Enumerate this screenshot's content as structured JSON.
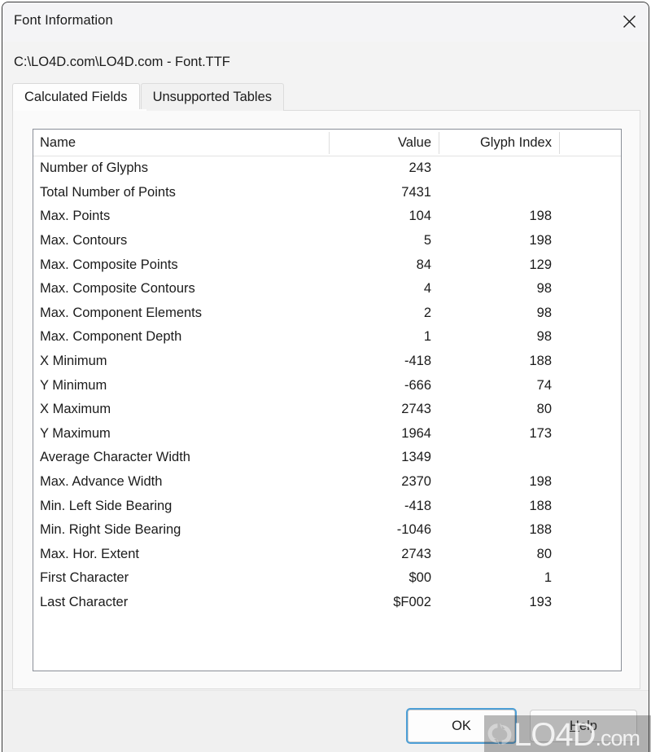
{
  "window": {
    "title": "Font Information",
    "close_icon": "close-icon"
  },
  "path": "C:\\LO4D.com\\LO4D.com - Font.TTF",
  "tabs": [
    {
      "label": "Calculated Fields",
      "active": true
    },
    {
      "label": "Unsupported Tables",
      "active": false
    }
  ],
  "table": {
    "columns": [
      "Name",
      "Value",
      "Glyph Index",
      ""
    ],
    "rows": [
      {
        "name": "Number of Glyphs",
        "value": "243",
        "glyph": ""
      },
      {
        "name": "Total Number of Points",
        "value": "7431",
        "glyph": ""
      },
      {
        "name": "Max. Points",
        "value": "104",
        "glyph": "198"
      },
      {
        "name": "Max. Contours",
        "value": "5",
        "glyph": "198"
      },
      {
        "name": "Max. Composite Points",
        "value": "84",
        "glyph": "129"
      },
      {
        "name": "Max. Composite Contours",
        "value": "4",
        "glyph": "98"
      },
      {
        "name": "Max. Component Elements",
        "value": "2",
        "glyph": "98"
      },
      {
        "name": "Max. Component Depth",
        "value": "1",
        "glyph": "98"
      },
      {
        "name": "X Minimum",
        "value": "-418",
        "glyph": "188"
      },
      {
        "name": "Y Minimum",
        "value": "-666",
        "glyph": "74"
      },
      {
        "name": "X Maximum",
        "value": "2743",
        "glyph": "80"
      },
      {
        "name": "Y Maximum",
        "value": "1964",
        "glyph": "173"
      },
      {
        "name": "Average Character Width",
        "value": "1349",
        "glyph": ""
      },
      {
        "name": "Max. Advance Width",
        "value": "2370",
        "glyph": "198"
      },
      {
        "name": "Min. Left Side Bearing",
        "value": "-418",
        "glyph": "188"
      },
      {
        "name": "Min. Right Side Bearing",
        "value": "-1046",
        "glyph": "188"
      },
      {
        "name": "Max. Hor. Extent",
        "value": "2743",
        "glyph": "80"
      },
      {
        "name": "First Character",
        "value": "$00",
        "glyph": "1"
      },
      {
        "name": "Last Character",
        "value": "$F002",
        "glyph": "193"
      }
    ]
  },
  "footer": {
    "ok_label": "OK",
    "help_accel": "H",
    "help_rest": "elp"
  },
  "watermark": {
    "brand": "LO4D",
    "suffix": ".com",
    "logo_icon": "refresh-circular-arrows-icon"
  },
  "colors": {
    "accent_focus": "#4d9fd6",
    "window_bg": "#f3f3f3",
    "titlebar_bg": "#f4f4f6",
    "panel_bg": "#fafafa",
    "list_bg": "#ffffff",
    "text": "#1b1b1b"
  }
}
